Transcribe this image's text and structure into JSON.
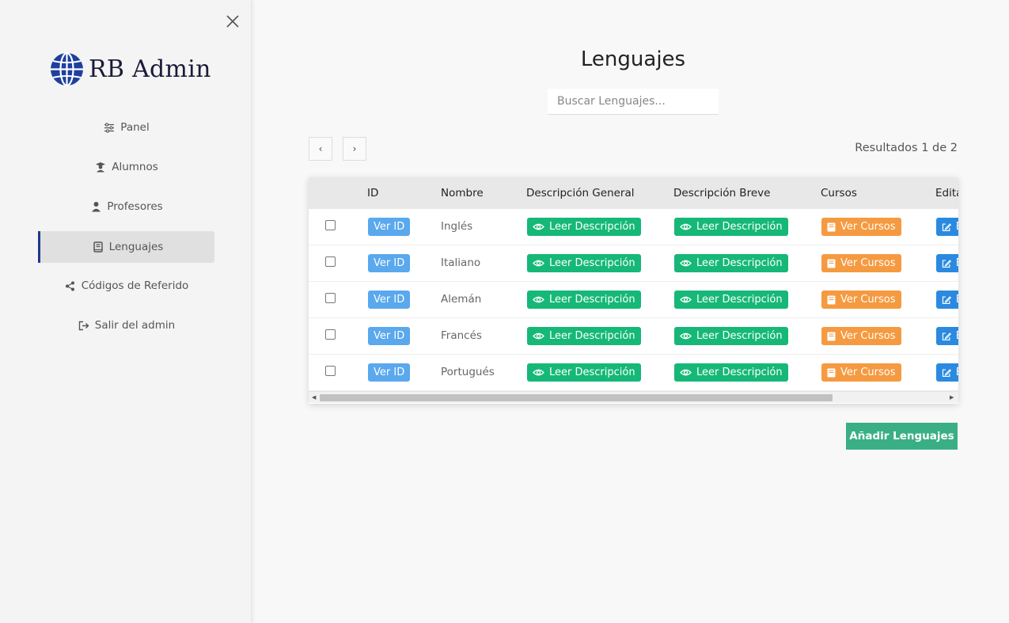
{
  "sidebar": {
    "logo_text": "RB Admin",
    "items": [
      {
        "label": "Panel",
        "icon": "sliders-icon"
      },
      {
        "label": "Alumnos",
        "icon": "graduate-icon"
      },
      {
        "label": "Profesores",
        "icon": "teacher-icon"
      },
      {
        "label": "Lenguajes",
        "icon": "book-icon",
        "active": true
      },
      {
        "label": "Códigos de Referido",
        "icon": "share-icon"
      },
      {
        "label": "Salir del admin",
        "icon": "logout-icon"
      }
    ]
  },
  "main": {
    "title": "Lenguajes",
    "search_placeholder": "Buscar Lenguajes...",
    "prev_label": "‹",
    "next_label": "›",
    "results_text": "Resultados 1 de 2",
    "add_button": "Añadir Lenguajes"
  },
  "table": {
    "headers": [
      "ID",
      "Nombre",
      "Descripción General",
      "Descripción Breve",
      "Cursos",
      "Editar"
    ],
    "rows": [
      {
        "id_label": "Ver ID",
        "nombre": "Inglés",
        "desc_general": "Leer Descripción",
        "desc_breve": "Leer Descripción",
        "cursos": "Ver Cursos",
        "editar": "E"
      },
      {
        "id_label": "Ver ID",
        "nombre": "Italiano",
        "desc_general": "Leer Descripción",
        "desc_breve": "Leer Descripción",
        "cursos": "Ver Cursos",
        "editar": "E"
      },
      {
        "id_label": "Ver ID",
        "nombre": "Alemán",
        "desc_general": "Leer Descripción",
        "desc_breve": "Leer Descripción",
        "cursos": "Ver Cursos",
        "editar": "E"
      },
      {
        "id_label": "Ver ID",
        "nombre": "Francés",
        "desc_general": "Leer Descripción",
        "desc_breve": "Leer Descripción",
        "cursos": "Ver Cursos",
        "editar": "E"
      },
      {
        "id_label": "Ver ID",
        "nombre": "Portugués",
        "desc_general": "Leer Descripción",
        "desc_breve": "Leer Descripción",
        "cursos": "Ver Cursos",
        "editar": "E"
      }
    ]
  },
  "colors": {
    "accent": "#1e3a8a",
    "id_button": "#5aa8ee",
    "desc_button": "#16b877",
    "cursos_button": "#f59a40",
    "edit_button": "#2b8ae0",
    "add_button": "#3aaf86"
  }
}
